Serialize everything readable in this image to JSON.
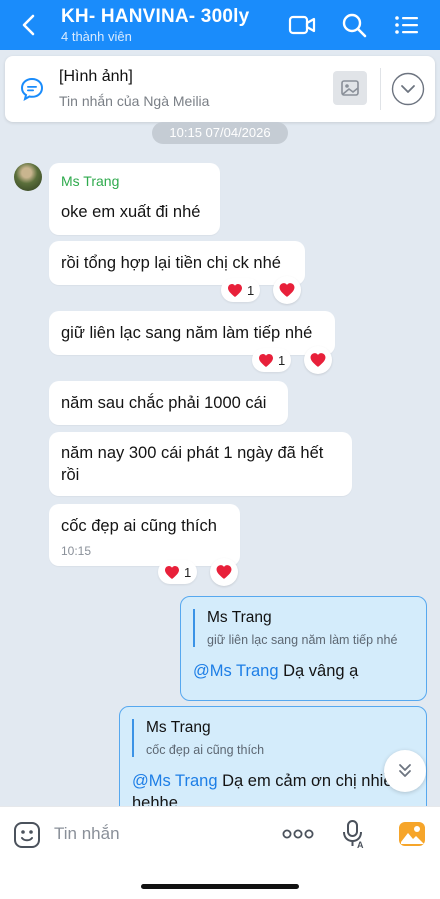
{
  "header": {
    "title": "KH- HANVINA- 300ly",
    "subtitle": "4 thành viên",
    "icons": [
      "back-arrow-icon",
      "video-call-icon",
      "search-icon",
      "menu-list-icon"
    ]
  },
  "pinned": {
    "title": "[Hình ảnh]",
    "subtitle": "Tin nhắn của Ngà Meilia"
  },
  "date_chip": "10:15 07/04/2026",
  "incoming": {
    "sender": "Ms Trang",
    "messages": [
      {
        "text": "oke em xuất đi nhé"
      },
      {
        "text": "rồi tổng hợp lại tiền chị ck nhé",
        "reaction_count": "1"
      },
      {
        "text": "giữ liên lạc sang năm làm tiếp nhé",
        "reaction_count": "1"
      },
      {
        "text": "năm sau chắc phải 1000 cái"
      },
      {
        "text": "năm nay 300 cái phát 1 ngày đã hết rồi"
      },
      {
        "text": "cốc đẹp ai cũng thích",
        "time": "10:15",
        "reaction_count": "1"
      }
    ]
  },
  "outgoing": [
    {
      "quote_name": "Ms Trang",
      "quote_text": "giữ liên lạc sang năm làm tiếp nhé",
      "mention": "@Ms Trang",
      "text": " Dạ vâng ạ"
    },
    {
      "quote_name": "Ms Trang",
      "quote_text": "cốc đẹp ai cũng thích",
      "mention": "@Ms Trang",
      "text": " Dạ em cảm ơn chị nhiều",
      "text2": "hehhe"
    }
  ],
  "composer": {
    "placeholder": "Tin nhắn"
  },
  "colors": {
    "header": "#1a8cfb",
    "sender_name": "#2faa4d",
    "mention": "#1d7ee6",
    "outgoing_bg": "#d4ecfb",
    "heart": "#e8203a"
  }
}
